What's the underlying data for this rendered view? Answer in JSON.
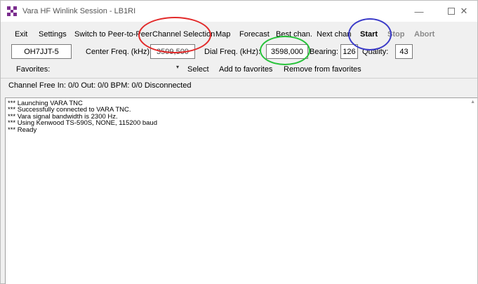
{
  "window": {
    "title": "Vara HF Winlink Session - LB1RI",
    "minimize_glyph": "—",
    "close_glyph": "✕"
  },
  "icons": {
    "app_icon": "checkered-purple-icon",
    "dropdown_arrow": "▾",
    "scroll_up": "▲"
  },
  "menu": {
    "items": [
      "Exit",
      "Settings",
      "Switch to Peer-to-Peer",
      "Channel Selection",
      "Map",
      "Forecast",
      "Best chan.",
      "Next chan",
      "Start",
      "Stop",
      "Abort"
    ]
  },
  "freq": {
    "callsign": "OH7JJT-5",
    "center_label": "Center Freq. (kHz):",
    "center_value": "3599,500",
    "dial_label": "Dial Freq. (kHz):",
    "dial_value": "3598,000",
    "bearing_label": "Bearing:",
    "bearing_value": "126",
    "quality_label": "Quality:",
    "quality_value": "43"
  },
  "favorites": {
    "label": "Favorites:",
    "selected": "",
    "select_label": "Select",
    "add_label": "Add to favorites",
    "remove_label": "Remove from favorites"
  },
  "status": {
    "text": "Channel Free  In: 0/0  Out: 0/0  BPM: 0/0  Disconnected"
  },
  "log": {
    "lines": [
      "*** Launching VARA TNC",
      "*** Successfully connected to VARA TNC.",
      "*** Vara signal bandwidth is 2300 Hz.",
      "*** Using Kenwood TS-590S, NONE, 115200 baud",
      "*** Ready"
    ]
  },
  "colors": {
    "annotation_red": "#e22a2a",
    "annotation_green": "#27c23a",
    "annotation_blue": "#3b3bc8",
    "window_bg": "#f0f0f0"
  }
}
